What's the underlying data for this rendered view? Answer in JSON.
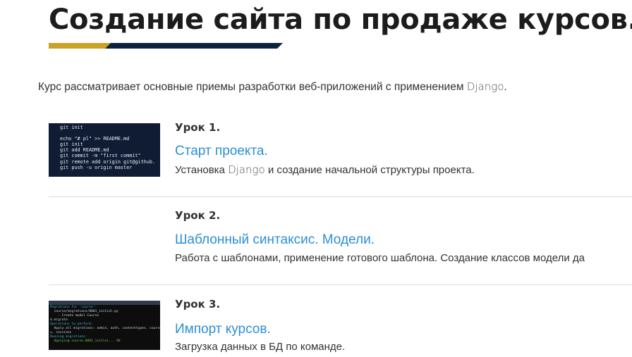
{
  "page": {
    "title": "Создание сайта по продаже курсов.",
    "intro_before": "Курс рассматривает основные приемы разработки веб-приложений с применением ",
    "intro_django": "Django",
    "intro_after": "."
  },
  "colors": {
    "accent_gold": "#c9a227",
    "accent_navy": "#0c2340",
    "link": "#2b8fd6"
  },
  "lessons": [
    {
      "number": "Урок 1.",
      "title": "Старт проекта.",
      "desc_before": "Установка ",
      "desc_django": "Django",
      "desc_after": " и создание начальной структуры проекта.",
      "thumbnail_lines": [
        "git init",
        "",
        "echo \"# pl\" >> README.md",
        "git init",
        "git add README.md",
        "git commit -m \"first commit\"",
        "git remote add origin git@github.",
        "git push -u origin master"
      ]
    },
    {
      "number": "Урок 2.",
      "title": "Шаблонный синтаксис. Модели.",
      "desc": "Работа с шаблонами, применение готового шаблона. Создание классов модели да"
    },
    {
      "number": "Урок 3.",
      "title": "Импорт курсов.",
      "desc": "Загрузка данных в БД по команде.",
      "thumbnail_lines": [
        "Migrations for 'course':",
        "  course/migrations/0001_initial.py",
        "    - Create model Course",
        "$ migrate",
        "Operations to perform:",
        "  Apply all migrations: admin, auth, contenttypes, course, inde",
        "x, sessions",
        "Running migrations:",
        "  Applying course.0001_initial... OK"
      ]
    }
  ]
}
